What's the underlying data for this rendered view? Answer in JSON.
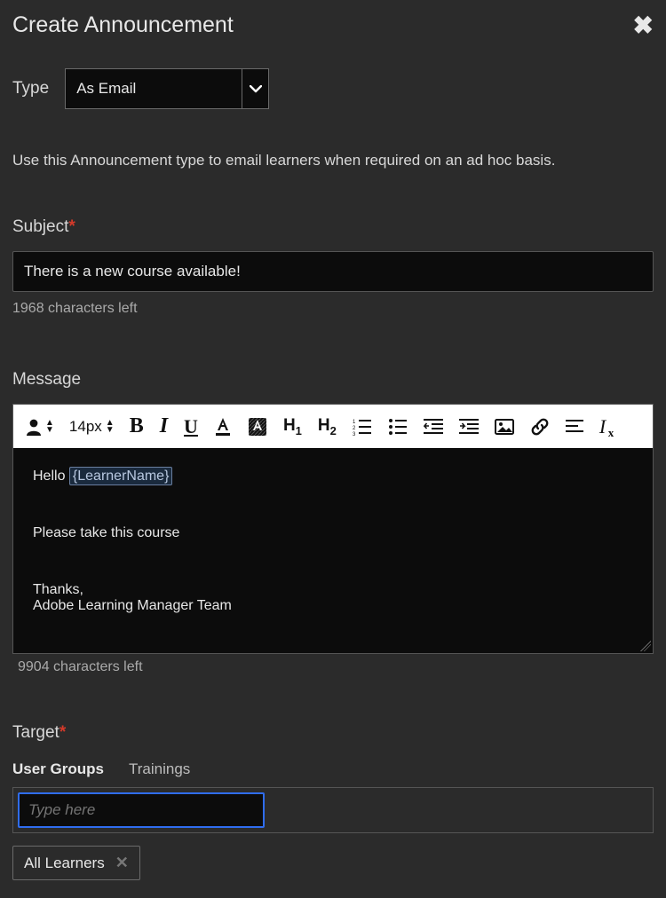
{
  "header": {
    "title": "Create Announcement"
  },
  "type": {
    "label": "Type",
    "value": "As Email"
  },
  "helper_text": "Use this Announcement type to email learners when required on an ad hoc basis.",
  "subject": {
    "label": "Subject",
    "value": "There is a new course available!",
    "counter": "1968 characters left"
  },
  "message": {
    "label": "Message",
    "font_size": "14px",
    "body_hello": "Hello ",
    "body_tag": "{LearnerName}",
    "body_line2": "Please take this course",
    "body_thanks": "Thanks,",
    "body_team": "Adobe Learning Manager Team",
    "counter": "9904 characters left"
  },
  "target": {
    "label": "Target",
    "tabs": {
      "groups": "User Groups",
      "trainings": "Trainings"
    },
    "placeholder": "Type here",
    "chip": "All Learners"
  },
  "toolbar_heading1": "H",
  "toolbar_heading1_sub": "1",
  "toolbar_heading2": "H",
  "toolbar_heading2_sub": "2"
}
